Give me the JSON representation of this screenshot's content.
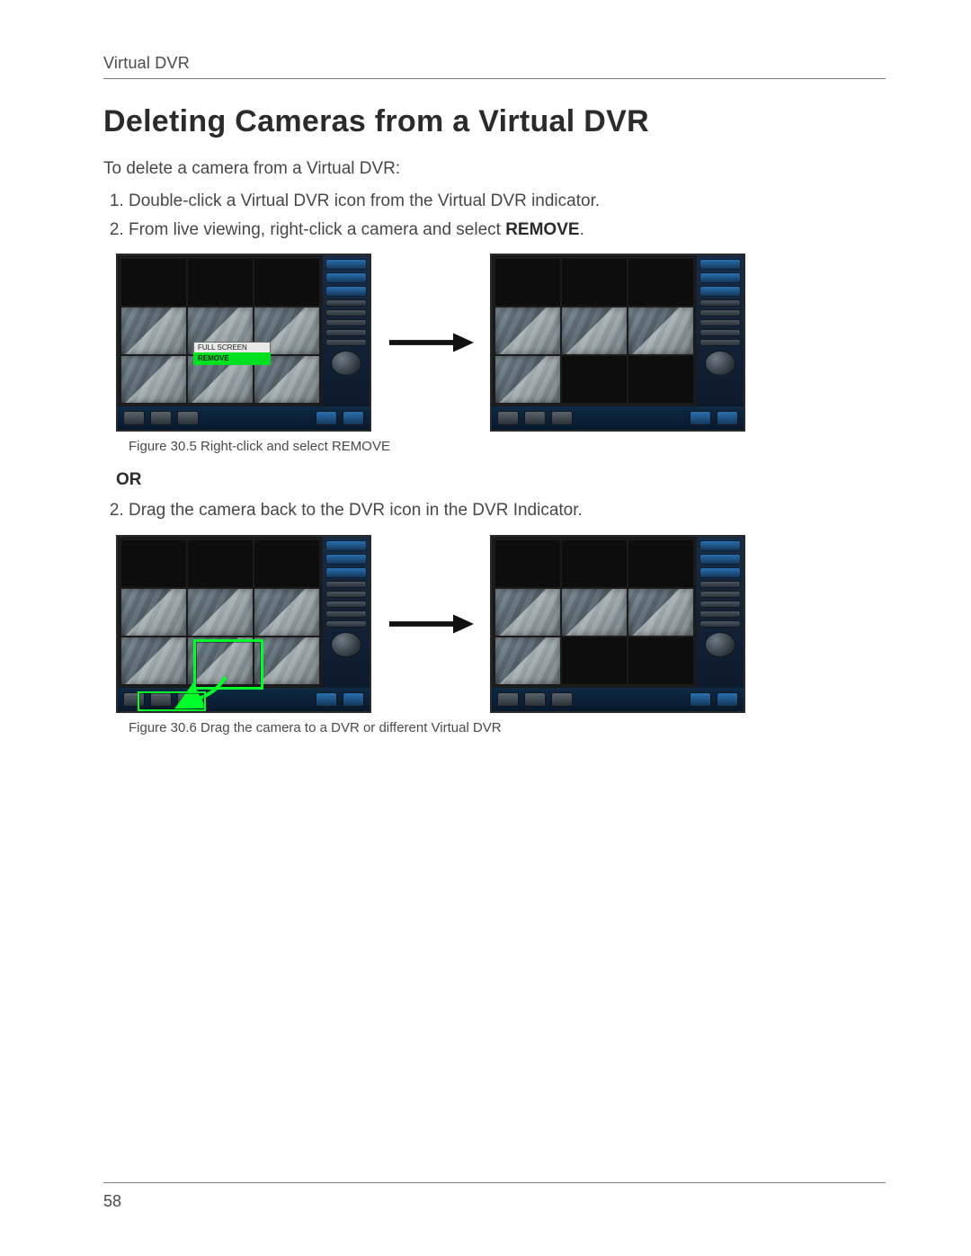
{
  "header": {
    "running": "Virtual DVR"
  },
  "title": "Deleting Cameras from a Virtual DVR",
  "intro": "To delete a camera from a Virtual DVR:",
  "steps_a": [
    "Double-click a Virtual DVR icon from the Virtual DVR indicator.",
    "From live viewing, right-click a camera and select "
  ],
  "steps_a_bold_tail": "REMOVE",
  "steps_a_tail_punct": ".",
  "context_menu": {
    "items": [
      "FULL SCREEN",
      "REMOVE"
    ],
    "highlight_index": 1
  },
  "caption_a": "Figure 30.5 Right-click and select REMOVE",
  "or": "OR",
  "steps_b_start": "2",
  "steps_b": [
    "Drag the camera back to the DVR icon in the DVR Indicator."
  ],
  "caption_b": "Figure 30.6 Drag the camera to a DVR or different Virtual DVR",
  "page_number": "58"
}
